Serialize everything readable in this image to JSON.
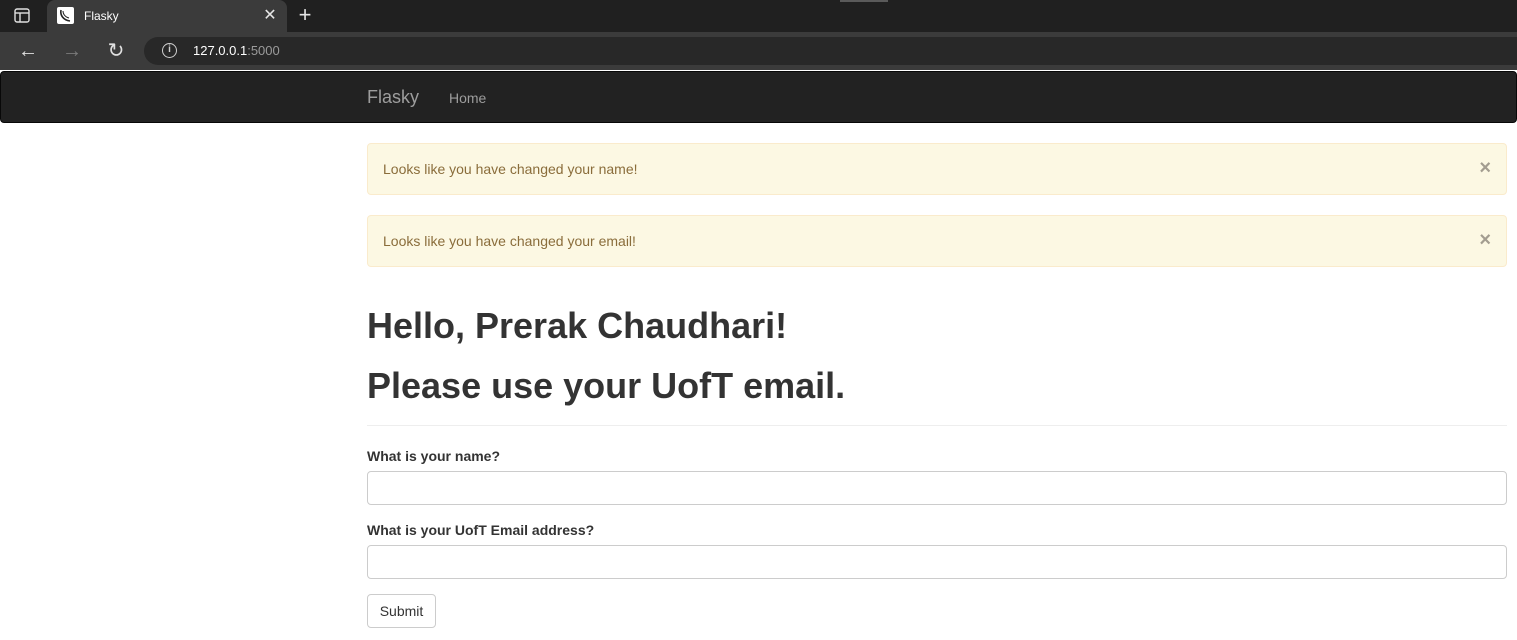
{
  "browser": {
    "tab_title": "Flasky",
    "url_host": "127.0.0.1",
    "url_port": ":5000",
    "icons": {
      "sidebar": "tab-sidebar-icon",
      "back": "back-arrow-icon",
      "forward": "forward-arrow-icon",
      "reload": "reload-icon",
      "info": "info-icon",
      "close": "close-icon",
      "new_tab": "plus-icon"
    },
    "glyphs": {
      "close": "✕",
      "new_tab": "+",
      "back": "←",
      "forward": "→",
      "reload": "↻",
      "info": "i"
    }
  },
  "navbar": {
    "brand": "Flasky",
    "home": "Home"
  },
  "alerts": [
    {
      "text": "Looks like you have changed your name!",
      "close": "×"
    },
    {
      "text": "Looks like you have changed your email!",
      "close": "×"
    }
  ],
  "main": {
    "greeting": "Hello, Prerak Chaudhari!",
    "notice": "Please use your UofT email."
  },
  "form": {
    "name_label": "What is your name?",
    "name_value": "",
    "email_label": "What is your UofT Email address?",
    "email_value": "",
    "submit_label": "Submit"
  },
  "colors": {
    "navbar_bg": "#222222",
    "alert_bg": "#fcf8e3",
    "alert_text": "#8a6d3b",
    "heading_text": "#333333"
  }
}
